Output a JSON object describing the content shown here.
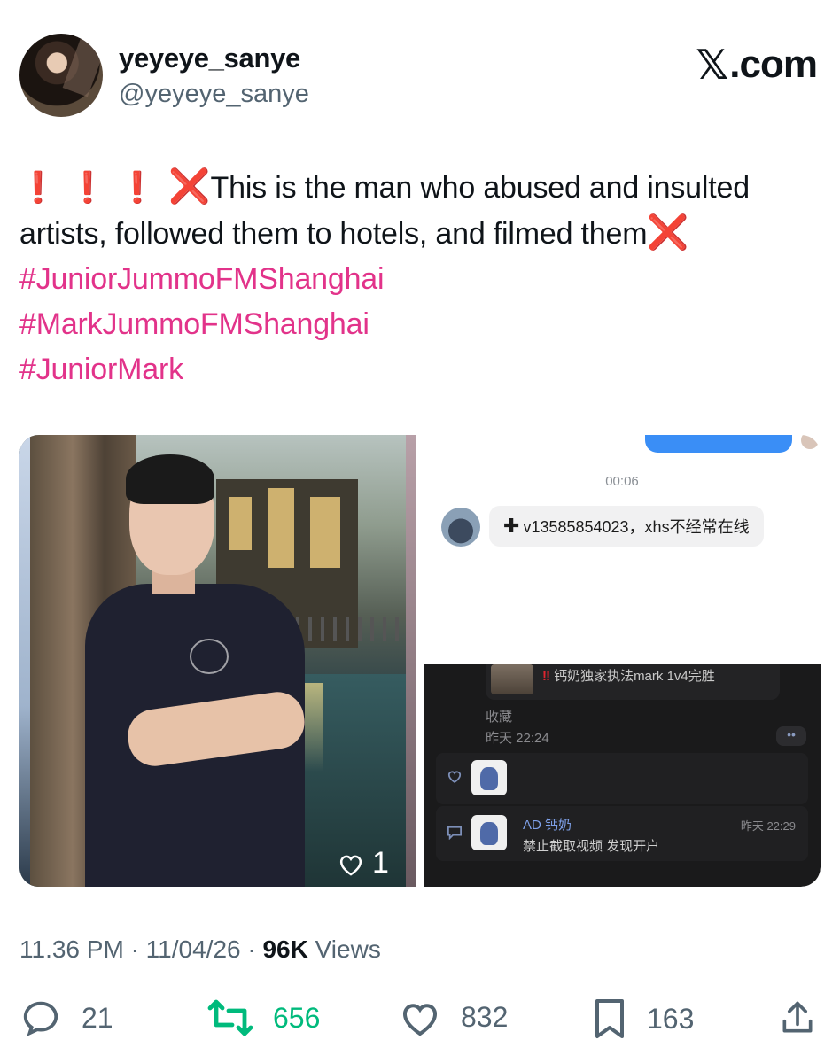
{
  "author": {
    "display_name": "yeyeye_sanye",
    "handle": "@yeyeye_sanye"
  },
  "brand": {
    "logo_text": ".com",
    "logo_mark": "𝕏"
  },
  "tweet": {
    "line1_text": "This is the man who abused and insulted",
    "line2_text": "artists, followed them to hotels, and filmed them",
    "emoji_exclamation": "❗",
    "emoji_cross": "❌",
    "hashtags": [
      "#JuniorJummoFMShanghai",
      "#MarkJummoFMShanghai",
      "#JuniorMark"
    ]
  },
  "media": {
    "photo_likes": "1",
    "chat": {
      "time": "00:06",
      "message_plus": "✚",
      "message": "v13585854023，xhs不经常在线"
    },
    "dark_panel": {
      "top_title_warn": "‼",
      "top_title": "钙奶独家执法mark 1v4完胜",
      "label": "收藏",
      "date": "昨天 22:24",
      "dots": "••",
      "comment_name": "AD 钙奶",
      "comment_text": "禁止截取视频 发现开户",
      "comment_time": "昨天 22:29"
    }
  },
  "meta": {
    "time": "11.36 PM",
    "date": "11/04/26",
    "views_count": "96K",
    "views_label": "Views"
  },
  "actions": {
    "replies": "21",
    "retweets": "656",
    "likes": "832",
    "bookmarks": "163"
  },
  "colors": {
    "hashtag": "#e2338a",
    "alert_red": "#e0242e",
    "retweet_green": "#00ba7c",
    "secondary_text": "#536471"
  }
}
